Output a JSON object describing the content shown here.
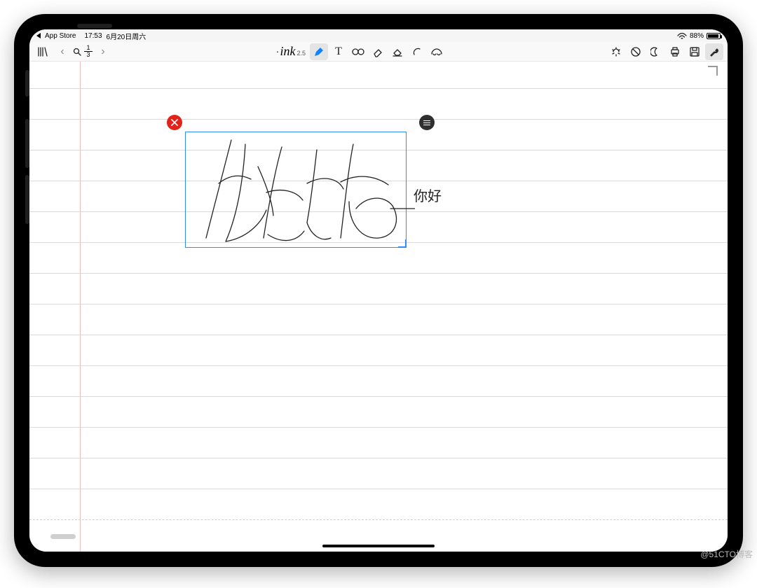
{
  "status": {
    "back_label": "App Store",
    "time": "17:53",
    "date": "6月20日周六",
    "battery_pct": "88%"
  },
  "toolbar": {
    "ink_label": "ink",
    "ink_version": "2.5",
    "page_current": "1",
    "page_total": "3"
  },
  "canvas": {
    "recognized_text": "你好"
  },
  "watermark": "@51CTO博客"
}
